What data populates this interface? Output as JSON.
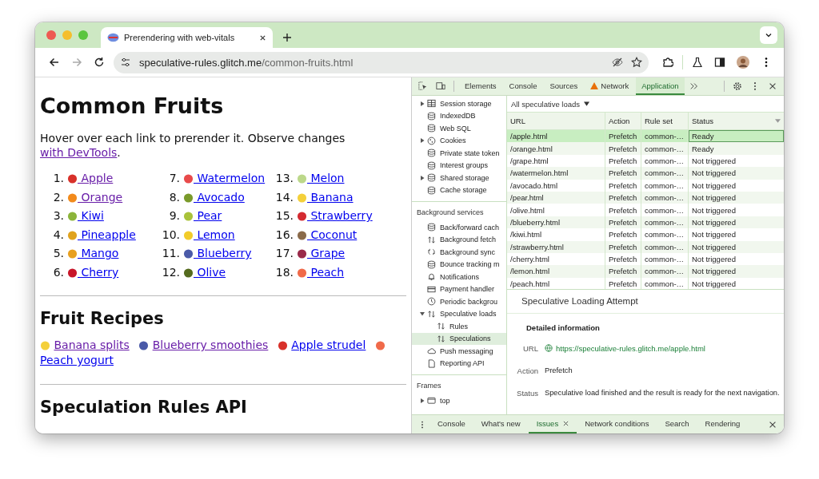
{
  "browser": {
    "tab": {
      "title": "Prerendering with web-vitals",
      "selected": true
    },
    "address": {
      "host": "speculative-rules.glitch.me",
      "path": "/common-fruits.html"
    },
    "back_disabled": false,
    "forward_disabled": true
  },
  "page": {
    "heading": "Common Fruits",
    "intro": "Hover over each link to prerender it. Observe changes ",
    "intro_link": {
      "text": "with DevTools",
      "visited": true
    },
    "intro_end": ".",
    "fruits": [
      {
        "number": "1.",
        "name": "Apple",
        "visited": true,
        "color": "#d8312a"
      },
      {
        "number": "2.",
        "name": "Orange",
        "visited": true,
        "color": "#f28a1c"
      },
      {
        "number": "3.",
        "name": "Kiwi",
        "visited": false,
        "color": "#8cb43a"
      },
      {
        "number": "4.",
        "name": "Pineapple",
        "visited": false,
        "color": "#e0a31e"
      },
      {
        "number": "5.",
        "name": "Mango",
        "visited": false,
        "color": "#e8a020"
      },
      {
        "number": "6.",
        "name": "Cherry",
        "visited": false,
        "color": "#c8162a"
      },
      {
        "number": "7.",
        "name": "Watermelon",
        "visited": false,
        "color": "#e84a4a"
      },
      {
        "number": "8.",
        "name": "Avocado",
        "visited": false,
        "color": "#7a9a2a"
      },
      {
        "number": "9.",
        "name": "Pear",
        "visited": false,
        "color": "#a9c23a"
      },
      {
        "number": "10.",
        "name": "Lemon",
        "visited": false,
        "color": "#f2cc2a"
      },
      {
        "number": "11.",
        "name": "Blueberry",
        "visited": false,
        "color": "#4a5aa8"
      },
      {
        "number": "12.",
        "name": "Olive",
        "visited": false,
        "color": "#556b1e"
      },
      {
        "number": "13.",
        "name": "Melon",
        "visited": false,
        "color": "#bcd88a"
      },
      {
        "number": "14.",
        "name": "Banana",
        "visited": false,
        "color": "#f4d03a"
      },
      {
        "number": "15.",
        "name": "Strawberry",
        "visited": false,
        "color": "#d42a30"
      },
      {
        "number": "16.",
        "name": "Coconut",
        "visited": false,
        "color": "#8a6a4a"
      },
      {
        "number": "17.",
        "name": "Grape",
        "visited": false,
        "color": "#9a2a4a"
      },
      {
        "number": "18.",
        "name": "Peach",
        "visited": false,
        "color": "#f06a4a"
      }
    ],
    "recipes_heading": "Fruit Recipes",
    "recipes": [
      {
        "name": "Banana splits",
        "visited": true,
        "color": "#f4d03a"
      },
      {
        "name": "Blueberry smoothies",
        "visited": true,
        "color": "#4a5aa8"
      },
      {
        "name": "Apple strudel",
        "visited": false,
        "color": "#d8312a"
      },
      {
        "name": "Peach yogurt",
        "visited": false,
        "color": "#f06a4a"
      }
    ],
    "api_heading": "Speculation Rules API"
  },
  "devtools": {
    "tabs": [
      {
        "label": "Elements",
        "selected": false,
        "warning": false
      },
      {
        "label": "Console",
        "selected": false,
        "warning": false
      },
      {
        "label": "Sources",
        "selected": false,
        "warning": false
      },
      {
        "label": "Network",
        "selected": false,
        "warning": true
      },
      {
        "label": "Application",
        "selected": true,
        "warning": false
      }
    ],
    "sidebar": [
      {
        "items": [
          {
            "label": "Session storage",
            "expanded": false,
            "selected": false
          },
          {
            "label": "IndexedDB",
            "selected": false
          },
          {
            "label": "Web SQL",
            "selected": false
          },
          {
            "label": "Cookies",
            "expanded": false,
            "selected": false
          },
          {
            "label": "Private state token",
            "selected": false
          },
          {
            "label": "Interest groups",
            "selected": false
          },
          {
            "label": "Shared storage",
            "expanded": false,
            "selected": false
          },
          {
            "label": "Cache storage",
            "selected": false
          }
        ]
      },
      {
        "title": "Background services",
        "items": [
          {
            "label": "Back/forward cach",
            "selected": false
          },
          {
            "label": "Background fetch",
            "selected": false
          },
          {
            "label": "Background sync",
            "selected": false
          },
          {
            "label": "Bounce tracking m",
            "selected": false
          },
          {
            "label": "Notifications",
            "selected": false
          },
          {
            "label": "Payment handler",
            "selected": false
          },
          {
            "label": "Periodic backgrou",
            "selected": false
          },
          {
            "label": "Speculative loads",
            "expanded": true,
            "selected": false,
            "children": [
              {
                "label": "Rules",
                "selected": false
              },
              {
                "label": "Speculations",
                "selected": true
              }
            ]
          },
          {
            "label": "Push messaging",
            "selected": false
          },
          {
            "label": "Reporting API",
            "selected": false
          }
        ]
      },
      {
        "title": "Frames",
        "items": [
          {
            "label": "top",
            "expanded": false,
            "selected": false
          }
        ]
      }
    ],
    "filter": "All speculative loads",
    "table": {
      "columns": [
        "URL",
        "Action",
        "Rule set",
        "Status"
      ],
      "rows": [
        {
          "url": "/apple.html",
          "action": "Prefetch",
          "rule_set": "common-…",
          "status": "Ready",
          "selected": true
        },
        {
          "url": "/orange.html",
          "action": "Prefetch",
          "rule_set": "common-…",
          "status": "Ready",
          "selected": false
        },
        {
          "url": "/grape.html",
          "action": "Prefetch",
          "rule_set": "common-…",
          "status": "Not triggered",
          "selected": false
        },
        {
          "url": "/watermelon.html",
          "action": "Prefetch",
          "rule_set": "common-…",
          "status": "Not triggered",
          "selected": false
        },
        {
          "url": "/avocado.html",
          "action": "Prefetch",
          "rule_set": "common-…",
          "status": "Not triggered",
          "selected": false
        },
        {
          "url": "/pear.html",
          "action": "Prefetch",
          "rule_set": "common-…",
          "status": "Not triggered",
          "selected": false
        },
        {
          "url": "/olive.html",
          "action": "Prefetch",
          "rule_set": "common-…",
          "status": "Not triggered",
          "selected": false
        },
        {
          "url": "/blueberry.html",
          "action": "Prefetch",
          "rule_set": "common-…",
          "status": "Not triggered",
          "selected": false
        },
        {
          "url": "/kiwi.html",
          "action": "Prefetch",
          "rule_set": "common-…",
          "status": "Not triggered",
          "selected": false
        },
        {
          "url": "/strawberry.html",
          "action": "Prefetch",
          "rule_set": "common-…",
          "status": "Not triggered",
          "selected": false
        },
        {
          "url": "/cherry.html",
          "action": "Prefetch",
          "rule_set": "common-…",
          "status": "Not triggered",
          "selected": false
        },
        {
          "url": "/lemon.html",
          "action": "Prefetch",
          "rule_set": "common-…",
          "status": "Not triggered",
          "selected": false
        },
        {
          "url": "/peach.html",
          "action": "Prefetch",
          "rule_set": "common-…",
          "status": "Not triggered",
          "selected": false
        }
      ]
    },
    "detail": {
      "title": "Speculative Loading Attempt",
      "section": "Detailed information",
      "fields": [
        {
          "label": "URL",
          "value": "https://speculative-rules.glitch.me/apple.html",
          "kind": "link"
        },
        {
          "label": "Action",
          "value": "Prefetch",
          "kind": "text"
        },
        {
          "label": "Status",
          "value": "Speculative load finished and the result is ready for the next navigation.",
          "kind": "text"
        }
      ]
    },
    "drawer_tabs": [
      {
        "label": "Console",
        "selected": false,
        "closable": false
      },
      {
        "label": "What's new",
        "selected": false,
        "closable": false
      },
      {
        "label": "Issues",
        "selected": true,
        "closable": true
      },
      {
        "label": "Network conditions",
        "selected": false,
        "closable": false
      },
      {
        "label": "Search",
        "selected": false,
        "closable": false
      },
      {
        "label": "Rendering",
        "selected": false,
        "closable": false
      }
    ]
  }
}
